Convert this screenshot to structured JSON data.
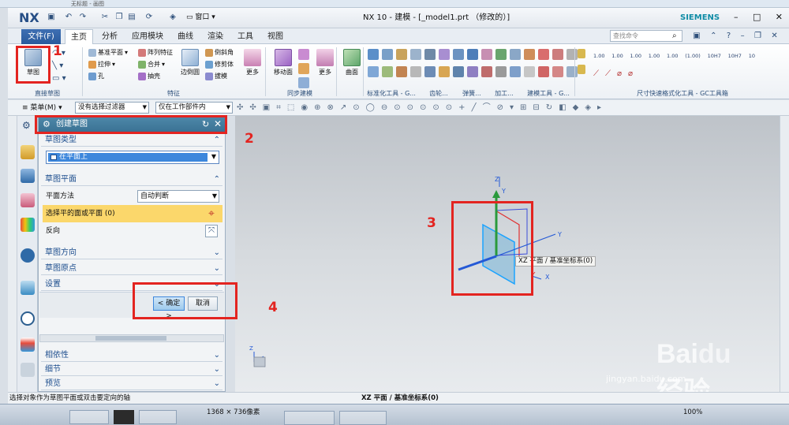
{
  "outer": {
    "title": "无标题 - 画图"
  },
  "app": {
    "logo": "NX",
    "title": "NX 10 - 建模 - [_model1.prt （修改的）]",
    "brand": "SIEMENS",
    "window_menu": "窗口"
  },
  "tabs": {
    "file": "文件(F)",
    "items": [
      "主页",
      "分析",
      "应用模块",
      "曲线",
      "渲染",
      "工具",
      "视图"
    ],
    "active": 0
  },
  "search": {
    "placeholder": "查找命令"
  },
  "ribbon": {
    "sketch": "草图",
    "direct_sketch_group": "直接草图",
    "feature_group": "特征",
    "sync_group": "同步建模",
    "std_tools_group": "标准化工具 - G...",
    "gear_group": "齿轮...",
    "spring_group": "弹簧...",
    "machining_group": "加工...",
    "modeling_tools_group": "建模工具 - G...",
    "dim_group": "尺寸快速格式化工具 - GC工具箱",
    "datum_plane": "基准平面",
    "extrude": "拉伸",
    "hole": "孔",
    "pattern": "阵列特征",
    "unite": "合并",
    "shell": "抽壳",
    "edge_blend": "边倒圆",
    "chamfer": "倒斜角",
    "trim_body": "修剪体",
    "draft": "拔模",
    "more1": "更多",
    "move_face": "移动面",
    "more2": "更多",
    "surface": "曲面",
    "dim_labels": [
      "1.00",
      "1.00",
      "1.00",
      "1.00",
      "1.00",
      "(1.00)",
      "10H7",
      "10H7",
      "10"
    ]
  },
  "toolbar2": {
    "menu": "菜单(M)",
    "filter": "没有选择过滤器",
    "scope": "仅在工作部件内"
  },
  "dialog": {
    "title": "创建草图",
    "sec_type": "草图类型",
    "type_value": "在平面上",
    "sec_plane": "草图平面",
    "plane_method_label": "平面方法",
    "plane_method_value": "自动判断",
    "select_plane": "选择平的面或平面 (0)",
    "reverse": "反向",
    "sec_orient": "草图方向",
    "sec_origin": "草图原点",
    "sec_settings": "设置",
    "ok": "< 确定 >",
    "cancel": "取消",
    "sec_assoc": "相依性",
    "sec_detail": "细节",
    "sec_preview": "预览"
  },
  "canvas": {
    "tooltip": "XZ 平面 / 基准坐标系(0)",
    "axis_x": "X",
    "axis_y": "Y",
    "axis_z": "Z",
    "watermark_site": "jingyan.baidu.com"
  },
  "status": {
    "left": "选择对象作为草图平面或双击要定向的轴",
    "center": "XZ 平面 / 基准坐标系(0)"
  },
  "taskbar": {
    "dims": "1368 × 736像素",
    "zoom": "100%"
  },
  "annotations": [
    "1",
    "2",
    "3",
    "4"
  ],
  "colors": {
    "annotation": "#e32420",
    "dialog_title": "#3b7294",
    "selection_row": "#fbd76b"
  }
}
